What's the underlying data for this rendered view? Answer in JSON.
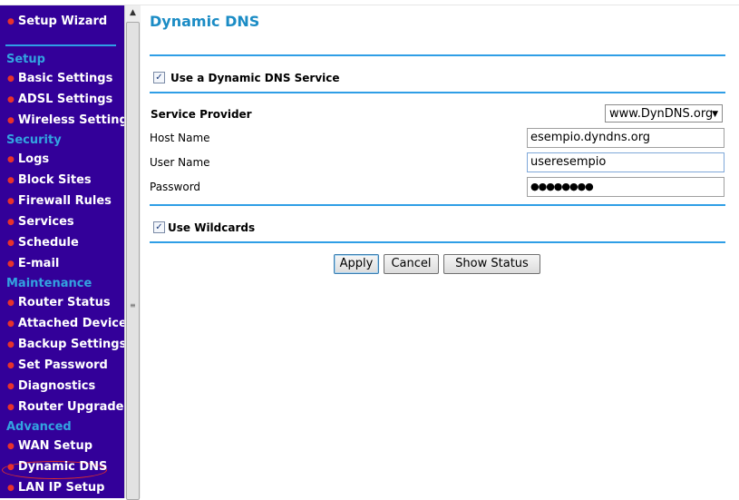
{
  "sidebar": {
    "top_item": "Setup Wizard",
    "sections": {
      "setup": "Setup",
      "security": "Security",
      "maintenance": "Maintenance",
      "advanced": "Advanced"
    },
    "items": {
      "basic_settings": "Basic Settings",
      "adsl_settings": "ADSL Settings",
      "wireless_settings": "Wireless Settings",
      "logs": "Logs",
      "block_sites": "Block Sites",
      "firewall_rules": "Firewall Rules",
      "services": "Services",
      "schedule": "Schedule",
      "email": "E-mail",
      "router_status": "Router Status",
      "attached_devices": "Attached Devices",
      "backup_settings": "Backup Settings",
      "set_password": "Set Password",
      "diagnostics": "Diagnostics",
      "router_upgrade": "Router Upgrade",
      "wan_setup": "WAN Setup",
      "dynamic_dns": "Dynamic DNS",
      "lan_ip_setup": "LAN IP Setup"
    },
    "bullet": "●",
    "active_item": "Dynamic DNS"
  },
  "main": {
    "title": "Dynamic DNS",
    "use_ddns": {
      "label": "Use a Dynamic DNS Service",
      "checked": true
    },
    "service_provider": {
      "label": "Service Provider",
      "value": "www.DynDNS.org"
    },
    "host_name": {
      "label": "Host Name",
      "value": "esempio.dyndns.org"
    },
    "user_name": {
      "label": "User Name",
      "value": "useresempio"
    },
    "password": {
      "label": "Password",
      "value": "●●●●●●●●"
    },
    "use_wildcards": {
      "label": "Use Wildcards",
      "checked": true
    },
    "buttons": {
      "apply": "Apply",
      "cancel": "Cancel",
      "show_status": "Show Status"
    }
  },
  "icons": {
    "checkmark": "✓",
    "dropdown_arrow": "▼",
    "scroll_up": "▲",
    "grip": "≡"
  },
  "colors": {
    "sidebar_bg": "#330099",
    "section_heading": "#33a3e0",
    "accent_rule": "#2f9ee6",
    "title": "#1b8cc5",
    "bullet": "#e8322c"
  }
}
